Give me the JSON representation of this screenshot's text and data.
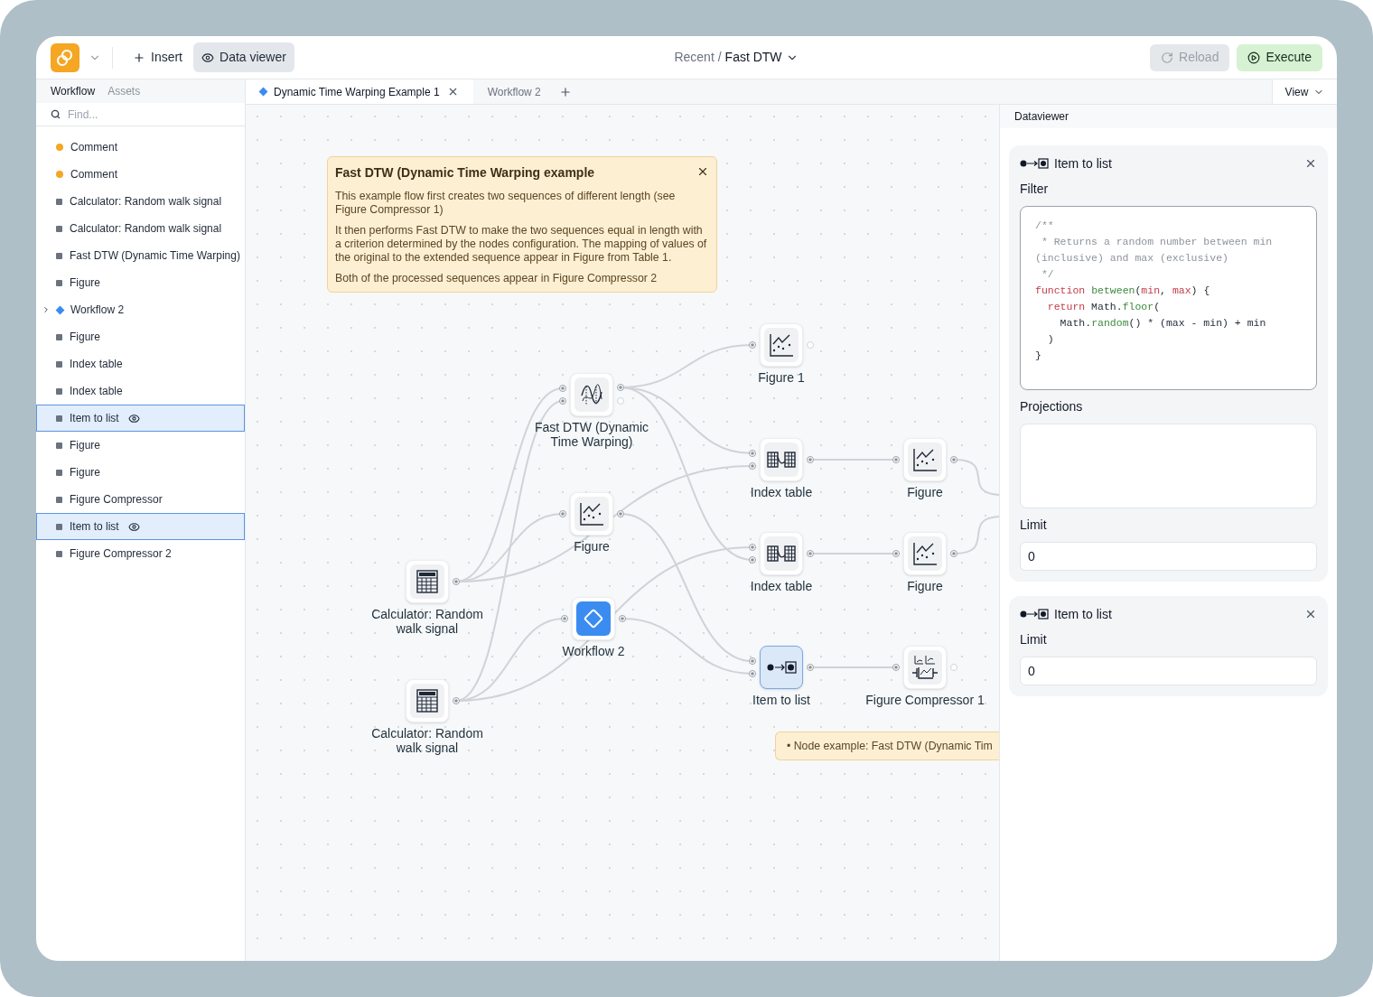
{
  "header": {
    "insert": "Insert",
    "data_viewer": {
      "label": "Data viewer",
      "selected": true
    },
    "breadcrumb_parent": "Recent /",
    "breadcrumb_current": "Fast DTW",
    "actions": [
      {
        "label": "Reload",
        "kind": "reload",
        "disabled": true
      },
      {
        "label": "Execute",
        "kind": "execute",
        "disabled": false
      }
    ]
  },
  "sidebar": {
    "tabs": [
      {
        "label": "Workflow",
        "selected": true
      },
      {
        "label": "Assets",
        "selected": false
      }
    ],
    "search": {
      "placeholder": "Find..."
    },
    "items": [
      {
        "label": "Comment",
        "kind": "comment",
        "selected": false
      },
      {
        "label": "Comment",
        "kind": "comment",
        "selected": false
      },
      {
        "label": "Calculator: Random walk signal",
        "kind": "node",
        "selected": false
      },
      {
        "label": "Calculator: Random walk signal",
        "kind": "node",
        "selected": false
      },
      {
        "label": "Fast DTW (Dynamic Time Warping)",
        "kind": "node",
        "selected": false
      },
      {
        "label": "Figure",
        "kind": "node",
        "selected": false
      },
      {
        "label": "Workflow 2",
        "kind": "workflow",
        "selected": false,
        "expanded": false
      },
      {
        "label": "Figure",
        "kind": "node",
        "selected": false
      },
      {
        "label": "Index table",
        "kind": "node",
        "selected": false
      },
      {
        "label": "Index table",
        "kind": "node",
        "selected": false
      },
      {
        "label": "Item to list",
        "kind": "node",
        "selected": true
      },
      {
        "label": "Figure",
        "kind": "node",
        "selected": false
      },
      {
        "label": "Figure",
        "kind": "node",
        "selected": false
      },
      {
        "label": "Figure Compressor",
        "kind": "node",
        "selected": false
      },
      {
        "label": "Item to list",
        "kind": "node",
        "selected": true
      },
      {
        "label": "Figure Compressor 2",
        "kind": "node",
        "selected": false
      }
    ]
  },
  "doc_tabs": [
    {
      "label": "Dynamic Time Warping Example 1",
      "selected": true
    },
    {
      "label": "Workflow 2",
      "selected": false
    }
  ],
  "view_menu": "View",
  "canvas": {
    "comment": {
      "title": "Fast DTW (Dynamic Time Warping example",
      "paragraphs": [
        "This example flow first creates two sequences of different length (see Figure Compressor 1)",
        "It then performs Fast DTW to make the two sequences equal in length with a criterion determined by the nodes configuration. The mapping of values of the original to the extended sequence appear in Figure from Table 1.",
        "Both of the processed sequences appear in Figure Compressor 2"
      ]
    },
    "nodes": [
      {
        "label": "Fast DTW (Dynamic Time Warping)",
        "kind": "dtw",
        "selected": false
      },
      {
        "label": "Figure 1",
        "kind": "figure",
        "selected": false
      },
      {
        "label": "Figure",
        "kind": "figure",
        "selected": false
      },
      {
        "label": "Index table",
        "kind": "index",
        "selected": false
      },
      {
        "label": "Figure",
        "kind": "figure",
        "selected": false
      },
      {
        "label": "Index table",
        "kind": "index",
        "selected": false
      },
      {
        "label": "Figure",
        "kind": "figure",
        "selected": false
      },
      {
        "label": "Calculator: Random walk signal",
        "kind": "calculator",
        "selected": false
      },
      {
        "label": "Workflow 2",
        "kind": "workflow",
        "selected": false
      },
      {
        "label": "Item to list",
        "kind": "itemlist",
        "selected": true
      },
      {
        "label": "Figure Compressor 1",
        "kind": "compressor",
        "selected": false
      },
      {
        "label": "Calculator: Random walk signal",
        "kind": "calculator",
        "selected": false
      }
    ],
    "note": "• Node example: Fast DTW (Dynamic Tim"
  },
  "dataviewer": {
    "title": "Dataviewer",
    "cards": [
      {
        "title": "Item to list",
        "fields": [
          {
            "kind": "code",
            "label": "Filter",
            "lines": [
              [
                {
                  "kind": "comment",
                  "text": "/**"
                }
              ],
              [
                {
                  "kind": "comment",
                  "text": " * Returns a random number between min"
                }
              ],
              [
                {
                  "kind": "comment",
                  "text": "(inclusive) and max (exclusive)"
                }
              ],
              [
                {
                  "kind": "comment",
                  "text": " */"
                }
              ],
              [
                {
                  "kind": "keyword",
                  "text": "function "
                },
                {
                  "kind": "call",
                  "text": "between"
                },
                {
                  "kind": "plain",
                  "text": "("
                },
                {
                  "kind": "keyword",
                  "text": "min"
                },
                {
                  "kind": "plain",
                  "text": ", "
                },
                {
                  "kind": "keyword",
                  "text": "max"
                },
                {
                  "kind": "plain",
                  "text": ") {"
                }
              ],
              [
                {
                  "kind": "keyword",
                  "text": "  return"
                },
                {
                  "kind": "plain",
                  "text": " Math."
                },
                {
                  "kind": "call",
                  "text": "floor"
                },
                {
                  "kind": "plain",
                  "text": "("
                }
              ],
              [
                {
                  "kind": "plain",
                  "text": "    Math."
                },
                {
                  "kind": "call",
                  "text": "random"
                },
                {
                  "kind": "plain",
                  "text": "() * (max - min) + min"
                }
              ],
              [
                {
                  "kind": "plain",
                  "text": "  )"
                }
              ],
              [
                {
                  "kind": "plain",
                  "text": "}"
                }
              ]
            ]
          },
          {
            "kind": "textarea",
            "label": "Projections"
          },
          {
            "kind": "input",
            "label": "Limit",
            "value": "0"
          }
        ]
      },
      {
        "title": "Item to list",
        "fields": [
          {
            "kind": "input",
            "label": "Limit",
            "value": "0"
          }
        ]
      }
    ]
  }
}
